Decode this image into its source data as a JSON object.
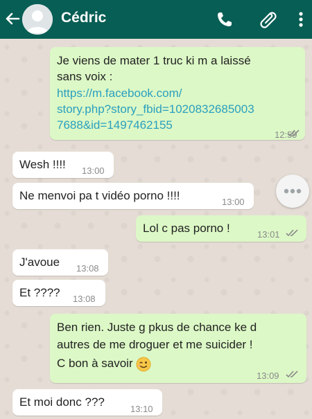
{
  "contact": {
    "name": "Cédric"
  },
  "colors": {
    "header": "#075e54",
    "chat_bg": "#e5ddd5",
    "outgoing": "#dcf8c6",
    "incoming": "#ffffff",
    "ticks": "#8a8a8a"
  },
  "icons": [
    "back-arrow-icon",
    "avatar-icon",
    "phone-icon",
    "paperclip-icon",
    "more-vert-icon",
    "typing-dots-icon",
    "double-check-icon",
    "winking-emoji-icon"
  ],
  "messages": [
    {
      "dir": "out",
      "line1": "Je viens de mater 1 truc ki m a laissé",
      "line2": "sans voix :",
      "link1": "https://m.facebook.com/",
      "link2": "story.php?story_fbid=1020832685003",
      "link3": "7688&id=1497462155",
      "time": "12:59"
    },
    {
      "dir": "in",
      "text": "Wesh !!!!",
      "time": "13:00"
    },
    {
      "dir": "in",
      "text": "Ne menvoi pa t vidéo porno !!!!",
      "time": "13:00"
    },
    {
      "dir": "out",
      "text": "Lol c pas porno !",
      "time": "13:01"
    },
    {
      "dir": "in",
      "text": "J'avoue",
      "time": "13:08"
    },
    {
      "dir": "in",
      "text": "Et ????",
      "time": "13:08"
    },
    {
      "dir": "out",
      "line1": "Ben rien. Juste g pkus de chance ke d",
      "line2": "autres de me droguer et me suicider !",
      "line3": "C bon à savoir",
      "time": "13:09"
    },
    {
      "dir": "in",
      "text": "Et moi donc ???",
      "time": "13:10"
    }
  ]
}
